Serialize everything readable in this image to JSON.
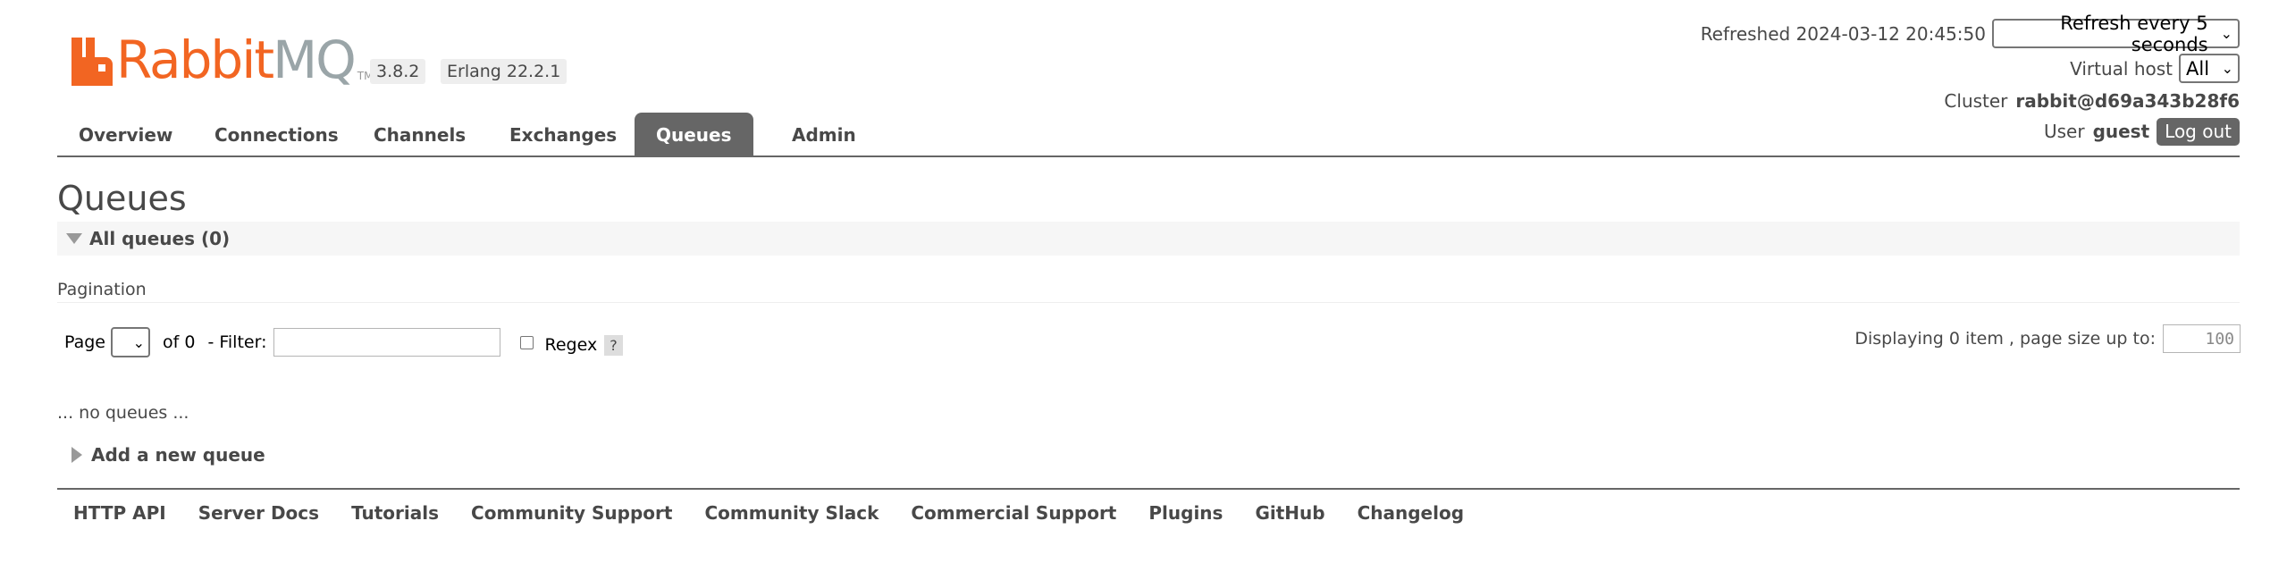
{
  "logo": {
    "rabbit": "Rabbit",
    "mq": "MQ",
    "tm": "TM"
  },
  "versions": {
    "rabbitmq": "3.8.2",
    "erlang": "Erlang 22.2.1"
  },
  "status": {
    "refreshed_label": "Refreshed",
    "refreshed_time": "2024-03-12 20:45:50",
    "refresh_select": "Refresh every 5 seconds",
    "vhost_label": "Virtual host",
    "vhost_select": "All",
    "cluster_label": "Cluster",
    "cluster_name": "rabbit@d69a343b28f6",
    "user_label": "User",
    "user_name": "guest",
    "logout": "Log out"
  },
  "tabs": [
    {
      "label": "Overview"
    },
    {
      "label": "Connections"
    },
    {
      "label": "Channels"
    },
    {
      "label": "Exchanges"
    },
    {
      "label": "Queues",
      "active": true
    },
    {
      "label": "Admin"
    }
  ],
  "main": {
    "title": "Queues",
    "section": "All queues (0)",
    "pagination_title": "Pagination",
    "page_label": "Page",
    "of_label": "of 0",
    "filter_label": "- Filter:",
    "regex_label": "Regex",
    "regex_help": "?",
    "displaying": "Displaying 0 item , page size up to:",
    "page_size": "100",
    "no_queues": "... no queues ...",
    "add_queue": "Add a new queue"
  },
  "footer": [
    "HTTP API",
    "Server Docs",
    "Tutorials",
    "Community Support",
    "Community Slack",
    "Commercial Support",
    "Plugins",
    "GitHub",
    "Changelog"
  ],
  "colors": {
    "brand_orange": "#f26522",
    "brand_grey": "#9aa5a8",
    "tab_active": "#666666",
    "text": "#484848"
  }
}
